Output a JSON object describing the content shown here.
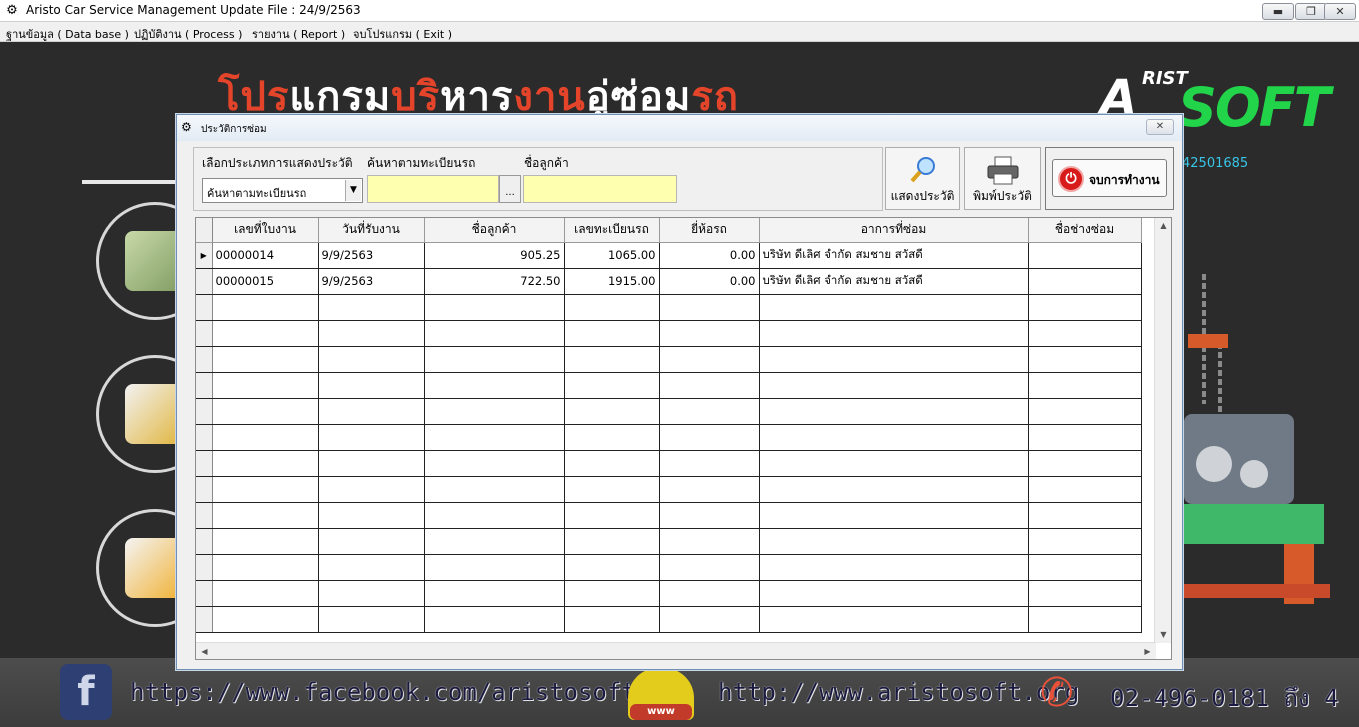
{
  "app": {
    "title": "Aristo Car Service Management   Update File : 24/9/2563",
    "minimize": "▬",
    "restore": "❐",
    "close": "✕"
  },
  "menu": [
    {
      "label": "ฐานข้อมูล ( Data base )"
    },
    {
      "label": "ปฏิบัติงาน ( Process )"
    },
    {
      "label": "รายงาน ( Report )"
    },
    {
      "label": "จบโปรแกรม ( Exit )"
    }
  ],
  "background": {
    "banner_parts": [
      {
        "text": "โปร",
        "color": "red"
      },
      {
        "text": "แกรม",
        "color": "white"
      },
      {
        "text": "บริ",
        "color": "red"
      },
      {
        "text": "หาร",
        "color": "white"
      },
      {
        "text": "งาน",
        "color": "red"
      },
      {
        "text": "อู่ซ่อม",
        "color": "white"
      },
      {
        "text": "รถ",
        "color": "red"
      }
    ],
    "logo_a": "A",
    "logo_rist": "RIST",
    "logo_soft": "SOFT",
    "phone_partial": "42501685"
  },
  "footer": {
    "facebook_icon": "f",
    "facebook": "https://www.facebook.com/aristosoftware",
    "www_badge": "www",
    "website": "http://www.aristosoft.org",
    "phone_icon": "✆",
    "phone": "02-496-0181 ถึง 4"
  },
  "dialog": {
    "title": "ประวัติการซ่อม",
    "close": "✕",
    "filter": {
      "type_label": "เลือกประเภทการแสดงประวัติ",
      "type_value": "ค้นหาตามทะเบียนรถ",
      "plate_label": "ค้นหาตามทะเบียนรถ",
      "plate_value": "",
      "lookup_button": "...",
      "customer_label": "ชื่อลูกค้า",
      "customer_value": ""
    },
    "buttons": {
      "show": "แสดงประวัติ",
      "print": "พิมพ์ประวัติ",
      "exit": "จบการทำงาน"
    },
    "grid": {
      "columns": [
        "เลขที่ใบงาน",
        "วันที่รับงาน",
        "ชื่อลูกค้า",
        "เลขทะเบียนรถ",
        "ยี่ห้อรถ",
        "อาการที่ซ่อม",
        "ชื่อช่างซ่อม"
      ],
      "rows": [
        [
          "00000014",
          "9/9/2563",
          "905.25",
          "1065.00",
          "0.00",
          "บริษัท ดีเลิศ  จำกัด  สมชาย สวัสดี",
          ""
        ],
        [
          "00000015",
          "9/9/2563",
          "722.50",
          "1915.00",
          "0.00",
          "บริษัท ดีเลิศ  จำกัด  สมชาย สวัสดี",
          ""
        ]
      ],
      "empty_rows": 13,
      "row_indicator": "▶"
    }
  },
  "colors": {
    "banner_red": "#e3442a",
    "logo_green": "#22d44a",
    "input_yellow": "#ffffb0",
    "exit_red": "#d91a1a"
  }
}
